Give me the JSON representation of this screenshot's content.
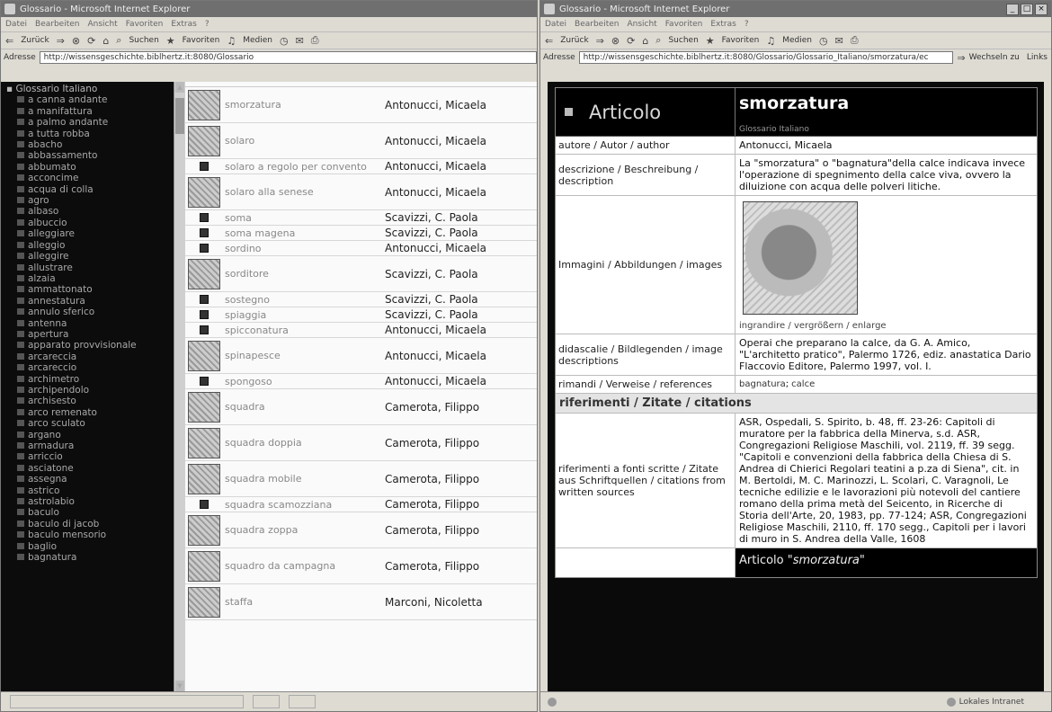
{
  "left_window": {
    "title": "Glossario - Microsoft Internet Explorer",
    "menu": [
      "Datei",
      "Bearbeiten",
      "Ansicht",
      "Favoriten",
      "Extras",
      "?"
    ],
    "toolbar": {
      "back": "Zurück",
      "search": "Suchen",
      "favorites": "Favoriten",
      "media": "Medien"
    },
    "address_label": "Adresse",
    "address": "http://wissensgeschichte.biblhertz.it:8080/Glossario",
    "sidebar": {
      "root": "Glossario Italiano",
      "items": [
        "a canna andante",
        "a manifattura",
        "a palmo andante",
        "a tutta robba",
        "abacho",
        "abbassamento",
        "abbumato",
        "acconcime",
        "acqua di colla",
        "agro",
        "albaso",
        "albuccio",
        "alleggiare",
        "alleggio",
        "alleggire",
        "allustrare",
        "alzaia",
        "ammattonato",
        "annestatura",
        "annulo sferico",
        "antenna",
        "apertura",
        "apparato provvisionale",
        "arcareccia",
        "arcareccio",
        "archimetro",
        "archipendolo",
        "archisesto",
        "arco remenato",
        "arco sculato",
        "argano",
        "armadura",
        "arriccio",
        "asciatone",
        "assegna",
        "astrico",
        "astrolabio",
        "baculo",
        "baculo di jacob",
        "baculo mensorio",
        "baglio",
        "bagnatura"
      ]
    },
    "entries": [
      {
        "term": "smorzatura",
        "author": "Antonucci, Micaela",
        "thumb": "big"
      },
      {
        "term": "solaro",
        "author": "Antonucci, Micaela",
        "thumb": "big"
      },
      {
        "term": "solaro a regolo per convento",
        "author": "Antonucci, Micaela",
        "thumb": "small"
      },
      {
        "term": "solaro alla senese",
        "author": "Antonucci, Micaela",
        "thumb": "big"
      },
      {
        "term": "soma",
        "author": "Scavizzi, C. Paola",
        "thumb": "small"
      },
      {
        "term": "soma magena",
        "author": "Scavizzi, C. Paola",
        "thumb": "small"
      },
      {
        "term": "sordino",
        "author": "Antonucci, Micaela",
        "thumb": "small"
      },
      {
        "term": "sorditore",
        "author": "Scavizzi, C. Paola",
        "thumb": "big"
      },
      {
        "term": "sostegno",
        "author": "Scavizzi, C. Paola",
        "thumb": "small"
      },
      {
        "term": "spiaggia",
        "author": "Scavizzi, C. Paola",
        "thumb": "small"
      },
      {
        "term": "spicconatura",
        "author": "Antonucci, Micaela",
        "thumb": "small"
      },
      {
        "term": "spinapesce",
        "author": "Antonucci, Micaela",
        "thumb": "big"
      },
      {
        "term": "spongoso",
        "author": "Antonucci, Micaela",
        "thumb": "small"
      },
      {
        "term": "squadra",
        "author": "Camerota, Filippo",
        "thumb": "big"
      },
      {
        "term": "squadra doppia",
        "author": "Camerota, Filippo",
        "thumb": "big"
      },
      {
        "term": "squadra mobile",
        "author": "Camerota, Filippo",
        "thumb": "big"
      },
      {
        "term": "squadra scamozziana",
        "author": "Camerota, Filippo",
        "thumb": "small"
      },
      {
        "term": "squadra zoppa",
        "author": "Camerota, Filippo",
        "thumb": "big"
      },
      {
        "term": "squadro da campagna",
        "author": "Camerota, Filippo",
        "thumb": "big"
      },
      {
        "term": "staffa",
        "author": "Marconi, Nicoletta",
        "thumb": "big"
      }
    ]
  },
  "right_window": {
    "title": "Glossario - Microsoft Internet Explorer",
    "menu": [
      "Datei",
      "Bearbeiten",
      "Ansicht",
      "Favoriten",
      "Extras",
      "?"
    ],
    "toolbar": {
      "back": "Zurück",
      "search": "Suchen",
      "favorites": "Favoriten",
      "media": "Medien"
    },
    "address_label": "Adresse",
    "address": "http://wissensgeschichte.biblhertz.it:8080/Glossario/Glossario_Italiano/smorzatura/ec",
    "go_label": "Wechseln zu",
    "links_label": "Links",
    "status_zone": "Lokales Intranet",
    "article": {
      "heading_left": "Articolo",
      "heading_term": "smorzatura",
      "heading_sub": "Glossario Italiano",
      "author_label": "autore / Autor / author",
      "author": "Antonucci, Micaela",
      "description_label": "descrizione / Beschreibung / description",
      "description": "La \"smorzatura\" o \"bagnatura\"della calce indicava invece l'operazione di spegnimento della calce viva, ovvero la diluizione con acqua delle polveri litiche.",
      "images_label": "Immagini / Abbildungen / images",
      "enlarge": "ingrandire / vergrößern / enlarge",
      "caption_label": "didascalie / Bildlegenden / image descriptions",
      "caption": "Operai che preparano la calce, da G. A. Amico, \"L'architetto pratico\", Palermo 1726, ediz. anastatica Dario Flaccovio Editore, Palermo 1997, vol. I.",
      "references_label": "rimandi / Verweise / references",
      "reference_1": "bagnatura",
      "reference_sep": ";",
      "reference_2": "calce",
      "citations_heading": "riferimenti / Zitate / citations",
      "sources_label": "riferimenti a fonti scritte / Zitate aus Schriftquellen / citations from written sources",
      "sources": "ASR, Ospedali, S. Spirito, b. 48, ff. 23-26: Capitoli di muratore per la fabbrica della Minerva, s.d. ASR, Congregazioni Religiose Maschili, vol. 2119, ff. 39 segg. \"Capitoli e convenzioni della fabbrica della Chiesa di S. Andrea di Chierici Regolari teatini a p.za di Siena\", cit. in M. Bertoldi, M. C. Marinozzi, L. Scolari, C. Varagnoli, Le tecniche edilizie e le lavorazioni più notevoli del cantiere romano della prima metà del Seicento, in Ricerche di Storia dell'Arte, 20, 1983, pp. 77-124; ASR, Congregazioni Religiose Maschili, 2110, ff. 170 segg., Capitoli per i lavori di muro in S. Andrea della Valle, 1608",
      "footer_prefix": "Articolo ",
      "footer_term": "\"smorzatura\""
    }
  }
}
